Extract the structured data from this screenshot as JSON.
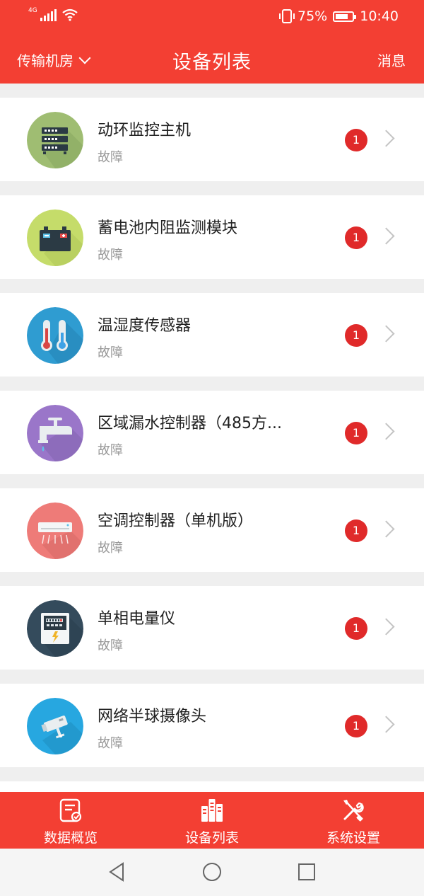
{
  "status_bar": {
    "network": "4G",
    "battery_percent": "75%",
    "battery_level": 0.75,
    "time": "10:40"
  },
  "header": {
    "room_selector": "传输机房",
    "title": "设备列表",
    "messages": "消息"
  },
  "colors": {
    "brand": "#f33f33",
    "badge": "#e02a2a"
  },
  "devices": [
    {
      "name": "动环监控主机",
      "status": "故障",
      "alarm_count": "1",
      "icon": "server-icon",
      "icon_bg": "#9fbd72"
    },
    {
      "name": "蓄电池内阻监测模块",
      "status": "故障",
      "alarm_count": "1",
      "icon": "battery-icon",
      "icon_bg": "#c5dc6a"
    },
    {
      "name": "温湿度传感器",
      "status": "故障",
      "alarm_count": "1",
      "icon": "thermometer-icon",
      "icon_bg": "#2f9cd1"
    },
    {
      "name": "区域漏水控制器（485方...",
      "status": "故障",
      "alarm_count": "1",
      "icon": "faucet-icon",
      "icon_bg": "#9a76c9"
    },
    {
      "name": "空调控制器（单机版）",
      "status": "故障",
      "alarm_count": "1",
      "icon": "air-conditioner-icon",
      "icon_bg": "#ee7b78"
    },
    {
      "name": "单相电量仪",
      "status": "故障",
      "alarm_count": "1",
      "icon": "power-meter-icon",
      "icon_bg": "#344b5c"
    },
    {
      "name": "网络半球摄像头",
      "status": "故障",
      "alarm_count": "1",
      "icon": "camera-icon",
      "icon_bg": "#27a7e0"
    }
  ],
  "tabs": [
    {
      "label": "数据概览",
      "icon": "data-overview-icon"
    },
    {
      "label": "设备列表",
      "icon": "device-list-icon"
    },
    {
      "label": "系统设置",
      "icon": "settings-tools-icon"
    }
  ],
  "nav": {
    "back": "back-icon",
    "home": "home-icon",
    "recents": "recents-icon"
  }
}
